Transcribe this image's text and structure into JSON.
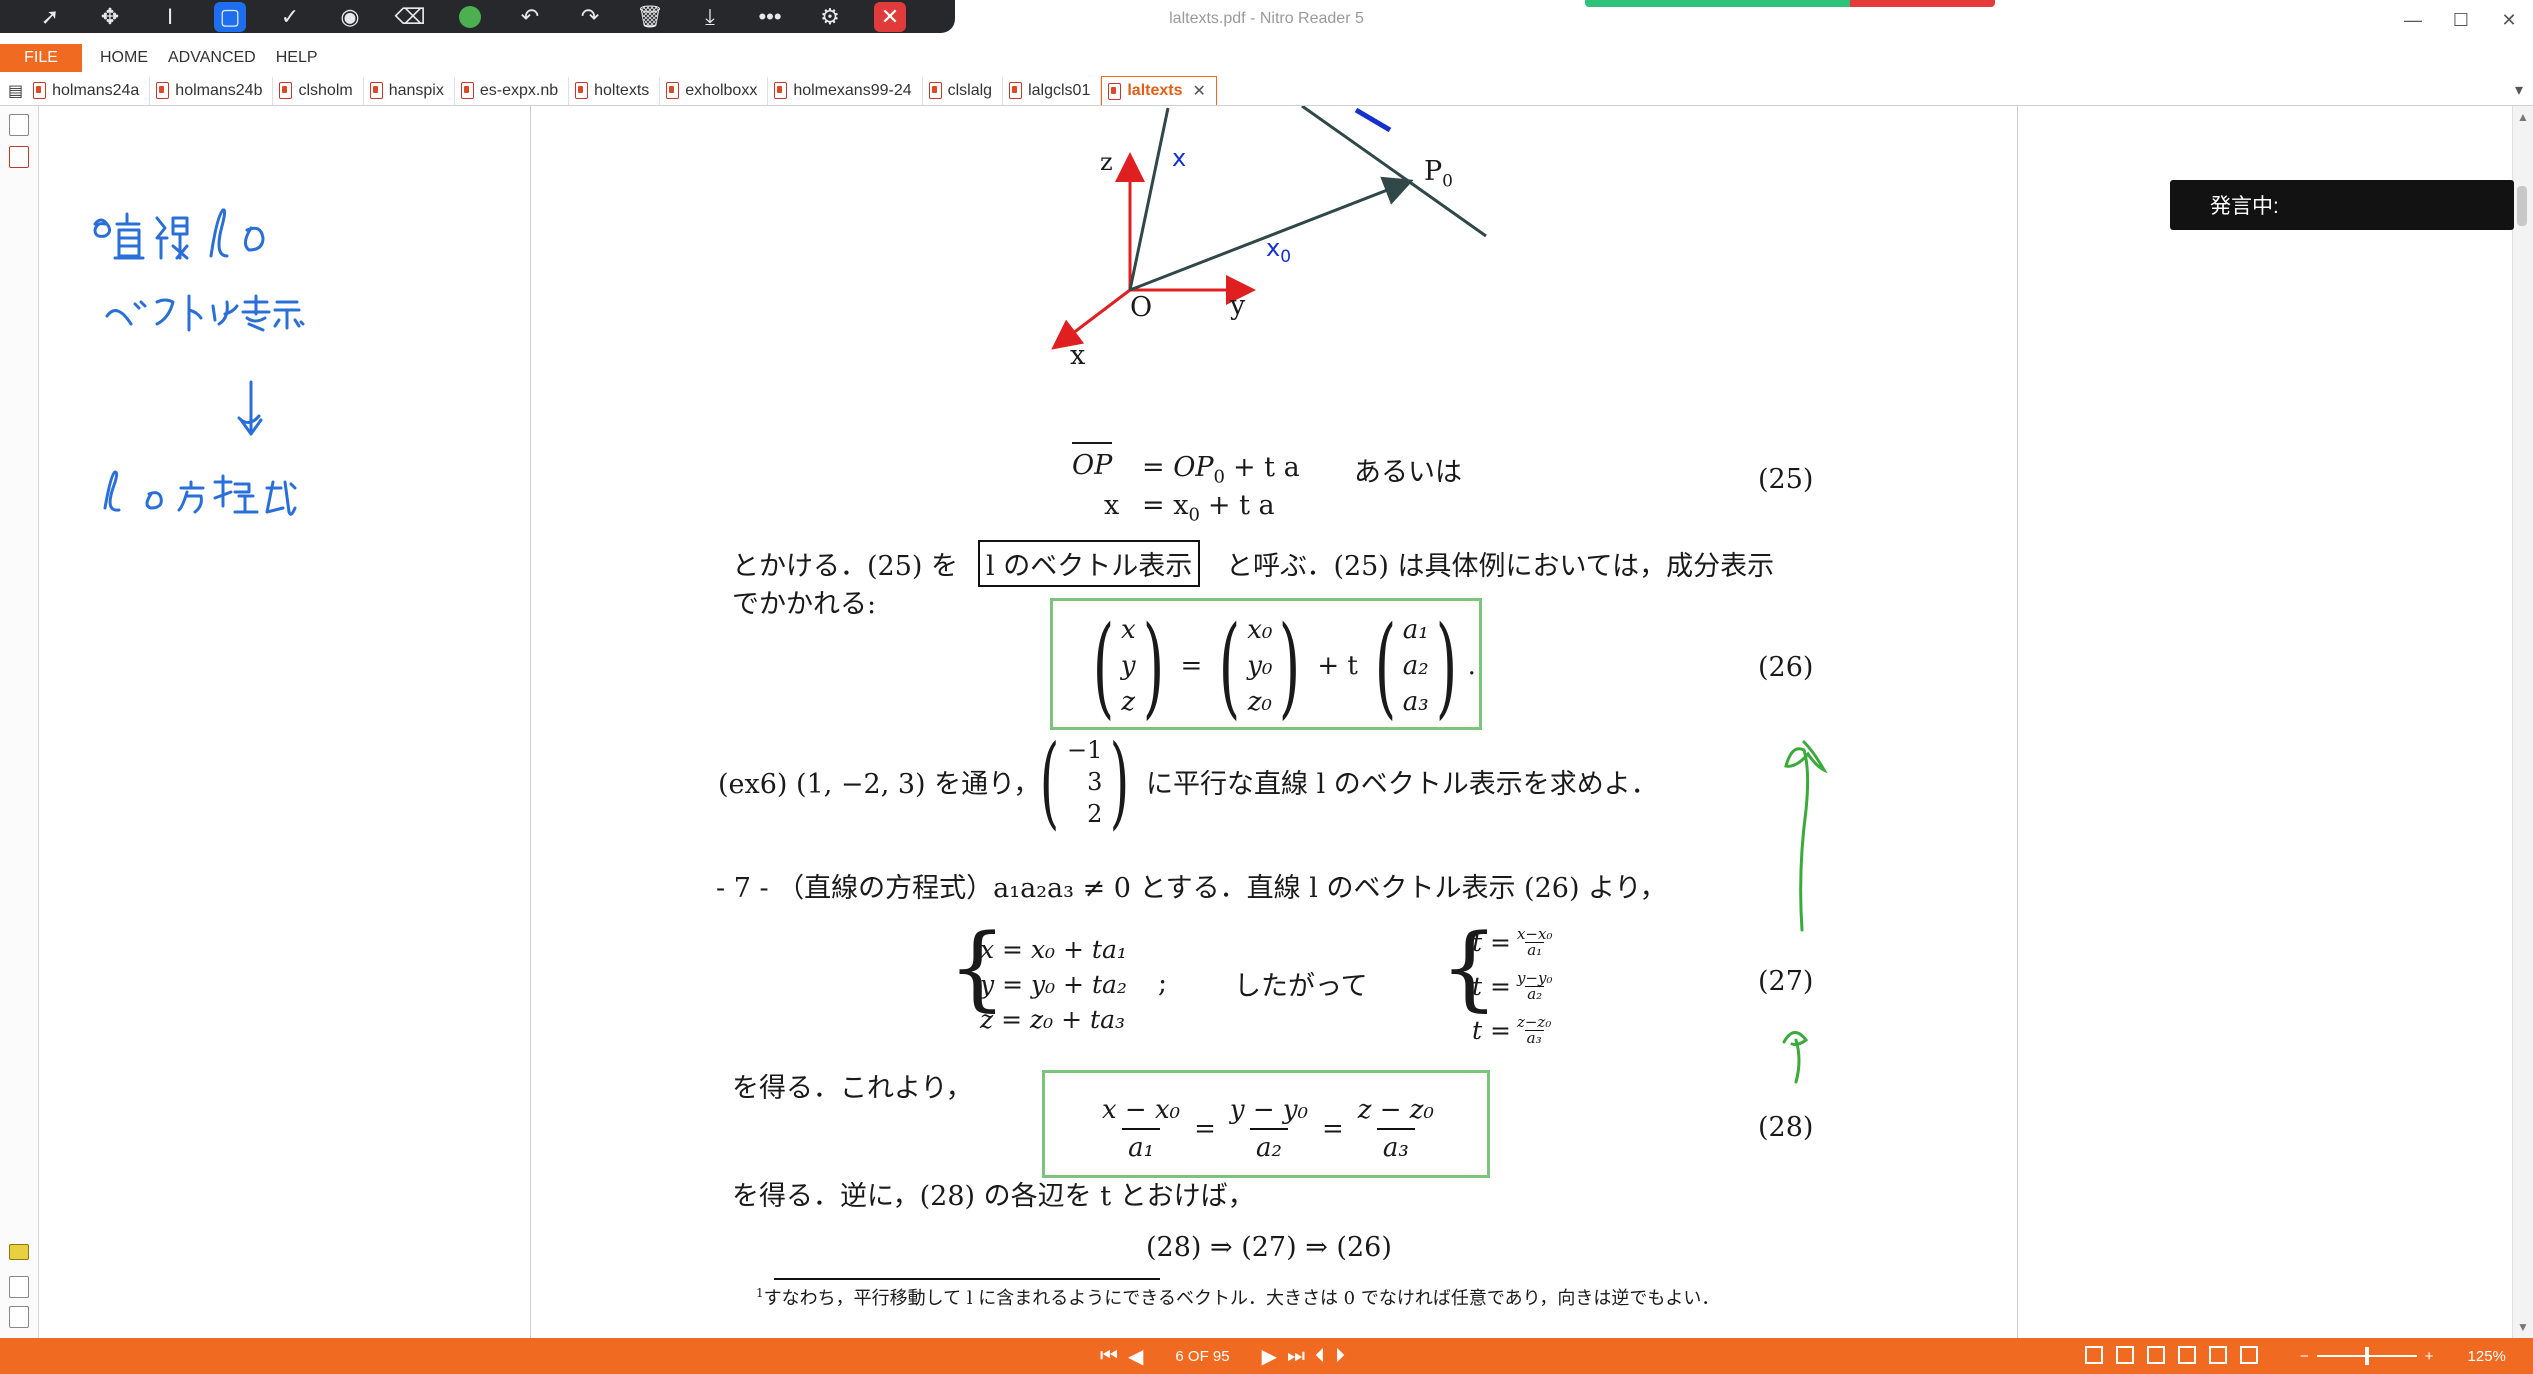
{
  "window": {
    "title": "laltexts.pdf - Nitro Reader 5",
    "minimize": "—",
    "maximize": "☐",
    "close": "✕"
  },
  "menu": {
    "file": "FILE",
    "items": [
      "HOME",
      "ADVANCED",
      "HELP"
    ]
  },
  "tabs": [
    {
      "label": "holmans24a"
    },
    {
      "label": "holmans24b"
    },
    {
      "label": "clsholm"
    },
    {
      "label": "hanspix"
    },
    {
      "label": "es-expx.nb"
    },
    {
      "label": "holtexts"
    },
    {
      "label": "exholboxx"
    },
    {
      "label": "holmexans99-24"
    },
    {
      "label": "clslalg"
    },
    {
      "label": "lalgcls01"
    },
    {
      "label": "laltexts",
      "active": true
    }
  ],
  "overlay": {
    "speaking_label": "発言中:"
  },
  "doc": {
    "fig": {
      "z": "z",
      "x_vec": "x",
      "P0": "P",
      "P0_sub": "0",
      "x0": "x",
      "x0_sub": "0",
      "O": "O",
      "y": "y",
      "x_axis": "x"
    },
    "eq25": {
      "lhs1": "OP",
      "mid1": "= OP",
      "mid1_sub": "0",
      "rhs1": "+ t a",
      "aruiwa": "あるいは",
      "lhs2": "x",
      "rhs2": "= x",
      "rhs2_sub": "0",
      "rhs2_tail": "+ t a",
      "num": "(25)"
    },
    "line1a": "とかける．(25) を",
    "boxed_term": "l のベクトル表示",
    "line1b": "と呼ぶ．(25) は具体例においては，成分表示",
    "line2": "でかかれる:",
    "eq26": {
      "num": "(26)",
      "v1": [
        "x",
        "y",
        "z"
      ],
      "v2": [
        "x₀",
        "y₀",
        "z₀"
      ],
      "v3": [
        "a₁",
        "a₂",
        "a₃"
      ],
      "eq": "=",
      "plus_t": "+ t",
      "dot": "."
    },
    "ex6": {
      "lead": "(ex6)  (1, −2, 3) を通り，",
      "vec": [
        "−1",
        "3",
        "2"
      ],
      "tail": "に平行な直線 l のベクトル表示を求めよ．"
    },
    "sec7": "- 7 - （直線の方程式）a₁a₂a₃ ≠ 0 とする．直線 l のベクトル表示 (26) より，",
    "eq27": {
      "rows": [
        "x = x₀ + ta₁",
        "y = y₀ + ta₂",
        "z = z₀ + ta₃"
      ],
      "semicolon": ";",
      "therefore": "したがって",
      "t": "t =",
      "fracs": [
        {
          "num": "x−x₀",
          "den": "a₁"
        },
        {
          "num": "y−y₀",
          "den": "a₂"
        },
        {
          "num": "z−z₀",
          "den": "a₃"
        }
      ],
      "num": "(27)"
    },
    "line3": "を得る．これより，",
    "eq28": {
      "fracs": [
        {
          "num": "x − x₀",
          "den": "a₁"
        },
        {
          "num": "y − y₀",
          "den": "a₂"
        },
        {
          "num": "z − z₀",
          "den": "a₃"
        }
      ],
      "eq": "=",
      "num": "(28)"
    },
    "line4": "を得る．逆に，(28) の各辺を t とおけば，",
    "implication": "(28) ⇒ (27) ⇒ (26)",
    "footnote_mark": "1",
    "footnote": "すなわち，平行移動して l に含まれるようにできるベクトル．大きさは 0 でなければ任意であり，向きは逆でもよい．"
  },
  "statusbar": {
    "page": "6 OF 95",
    "zoom_minus": "−",
    "zoom_plus": "+",
    "zoom": "125%"
  },
  "colors": {
    "accent": "#f06a22",
    "fig_red": "#e02020",
    "fig_blue": "#1530d0",
    "ink_blue": "#2a6fd8",
    "ink_green": "#3aaa3a",
    "box_green": "#7cc47c"
  }
}
